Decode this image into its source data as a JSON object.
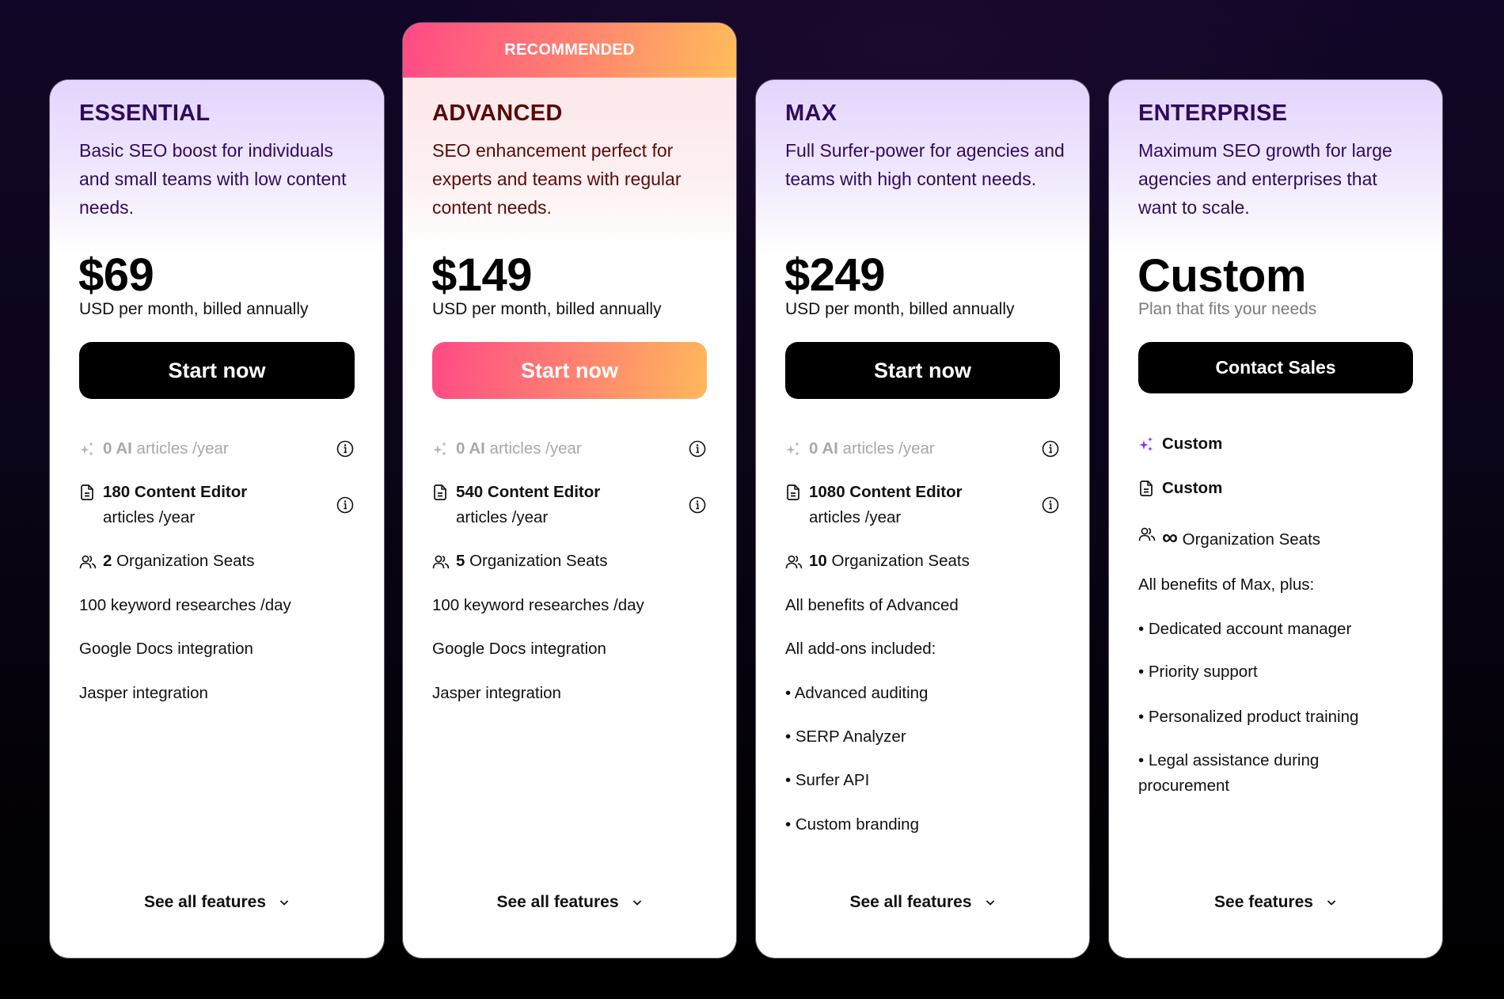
{
  "plans": [
    {
      "name": "ESSENTIAL",
      "description": "Basic SEO boost for individuals and small teams with low content needs.",
      "price": "$69",
      "price_note": "USD per month, billed annually",
      "cta": "Start now",
      "features": {
        "ai_articles": {
          "count": "0 AI",
          "label": " articles /year"
        },
        "content_editor": {
          "count": "180 Content Editor",
          "label": "articles /year"
        },
        "seats": {
          "count": "2",
          "label": " Organization Seats"
        },
        "extras": [
          "100 keyword researches /day",
          "Google Docs integration",
          "Jasper integration"
        ]
      },
      "see_features": "See all features"
    },
    {
      "badge": "RECOMMENDED",
      "name": "ADVANCED",
      "description": "SEO enhancement perfect for experts and teams with regular content needs.",
      "price": "$149",
      "price_note": "USD per month, billed annually",
      "cta": "Start now",
      "features": {
        "ai_articles": {
          "count": "0 AI",
          "label": " articles /year"
        },
        "content_editor": {
          "count": "540 Content Editor",
          "label": "articles /year"
        },
        "seats": {
          "count": "5",
          "label": " Organization Seats"
        },
        "extras": [
          "100 keyword researches /day",
          "Google Docs integration",
          "Jasper integration"
        ]
      },
      "see_features": "See all features"
    },
    {
      "name": "MAX",
      "description": "Full Surfer-power for agencies and teams with high content needs.",
      "price": "$249",
      "price_note": "USD per month, billed annually",
      "cta": "Start now",
      "features": {
        "ai_articles": {
          "count": "0 AI",
          "label": " articles /year"
        },
        "content_editor": {
          "count": "1080 Content Editor",
          "label": "articles /year"
        },
        "seats": {
          "count": "10",
          "label": " Organization Seats"
        },
        "extras": [
          "All benefits of Advanced",
          "All add-ons included:",
          "• Advanced auditing",
          "• SERP Analyzer",
          "• Surfer API",
          "• Custom branding"
        ]
      },
      "see_features": "See all features"
    },
    {
      "name": "ENTERPRISE",
      "description": "Maximum SEO growth for large agencies and enterprises that want to scale.",
      "price": "Custom",
      "price_note": "Plan that fits your needs",
      "cta": "Contact Sales",
      "features": {
        "ai_articles": {
          "count": "Custom",
          "label": ""
        },
        "content_editor": {
          "count": "Custom",
          "label": ""
        },
        "seats": {
          "count": "∞",
          "label": " Organization Seats"
        },
        "extras": [
          "All benefits of Max, plus:",
          "• Dedicated account manager",
          "• Priority support",
          "• Personalized product training",
          "• Legal assistance during procurement"
        ]
      },
      "see_features": "See features"
    }
  ],
  "icons": {
    "ai": "sparkles-icon",
    "editor": "document-icon",
    "seats": "users-icon",
    "info": "info-icon",
    "chevron": "chevron-down-icon"
  },
  "colors": {
    "accent_gradient_start": "#ff4a86",
    "accent_gradient_end": "#ffbc5a",
    "purple_text": "#2e0b5c",
    "red_text": "#5a0a0a",
    "sparkle_purple": "#7b2ff7"
  }
}
